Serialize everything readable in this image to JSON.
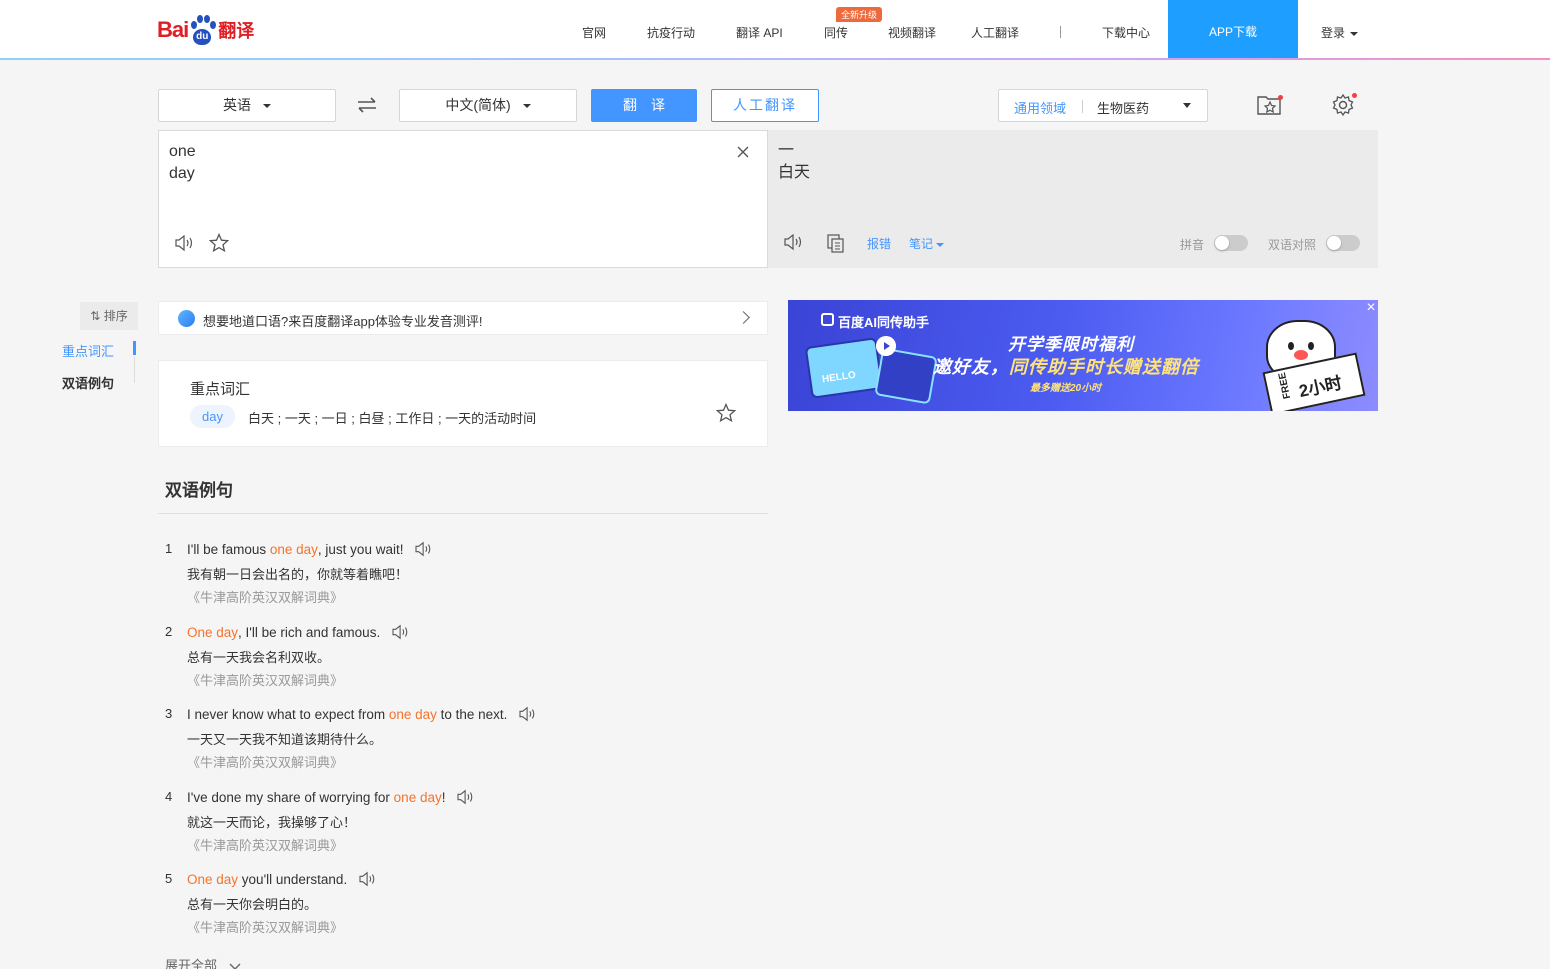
{
  "header": {
    "logo_text": "Bai",
    "logo_paw_text": "du",
    "logo_suffix": "翻译",
    "nav": [
      {
        "label": "官网"
      },
      {
        "label": "抗疫行动"
      },
      {
        "label": "翻译 API"
      },
      {
        "label": "同传"
      },
      {
        "label": "视频翻译"
      },
      {
        "label": "人工翻译"
      },
      {
        "label": "下载中心"
      }
    ],
    "badge": "全新升级",
    "app_download": "APP下载",
    "login": "登录"
  },
  "toolbar": {
    "source_lang": "英语",
    "target_lang": "中文(简体)",
    "translate_btn": "翻译",
    "human_btn": "人工翻译",
    "domain_label": "通用领域",
    "domain_value": "生物医药"
  },
  "input": {
    "text": "one\nday"
  },
  "output": {
    "text": "一\n白天",
    "report_error": "报错",
    "notes": "笔记",
    "pinyin_label": "拼音",
    "pinyin_on": false,
    "bilingual_label": "双语对照",
    "bilingual_on": false
  },
  "sidebar": {
    "sort": "排序",
    "items": [
      {
        "label": "重点词汇"
      },
      {
        "label": "双语例句"
      }
    ]
  },
  "promo": {
    "text": "想要地道口语?来百度翻译app体验专业发音测评!"
  },
  "keywords": {
    "title": "重点词汇",
    "items": [
      {
        "word": "day",
        "definition": "白天 ; 一天 ; 一日 ; 白昼 ; 工作日 ; 一天的活动时间"
      }
    ]
  },
  "examples": {
    "title": "双语例句",
    "items": [
      {
        "num": "1",
        "pre": "I'll be famous ",
        "hl": "one day",
        "post": ", just you wait!",
        "zh": "我有朝一日会出名的，你就等着瞧吧！",
        "source": "《牛津高阶英汉双解词典》"
      },
      {
        "num": "2",
        "pre": "",
        "hl": "One day",
        "post": ", I'll be rich and famous.",
        "zh": "总有一天我会名利双收。",
        "source": "《牛津高阶英汉双解词典》"
      },
      {
        "num": "3",
        "pre": "I never know what to expect from ",
        "hl": "one day",
        "post": " to the next.",
        "zh": "一天又一天我不知道该期待什么。",
        "source": "《牛津高阶英汉双解词典》"
      },
      {
        "num": "4",
        "pre": "I've done my share of worrying for ",
        "hl": "one day",
        "post": "!",
        "zh": "就这一天而论，我操够了心！",
        "source": "《牛津高阶英汉双解词典》"
      },
      {
        "num": "5",
        "pre": "",
        "hl": "One day",
        "post": " you'll understand.",
        "zh": "总有一天你会明白的。",
        "source": "《牛津高阶英汉双解词典》"
      }
    ],
    "expand_all": "展开全部"
  },
  "ad": {
    "brand": "百度AI同传助手",
    "line1": "开学季限时福利",
    "line2a": "邀好友，",
    "line2b": "同传助手时长赠送翻倍",
    "line3": "最多赠送20小时",
    "hello": "HELLO",
    "free": "FREE",
    "hours": "2小时"
  },
  "colors": {
    "accent": "#4395ff",
    "highlight": "#f5732c",
    "brand_red": "#de1f26",
    "app_download_bg": "#1e9fff"
  }
}
